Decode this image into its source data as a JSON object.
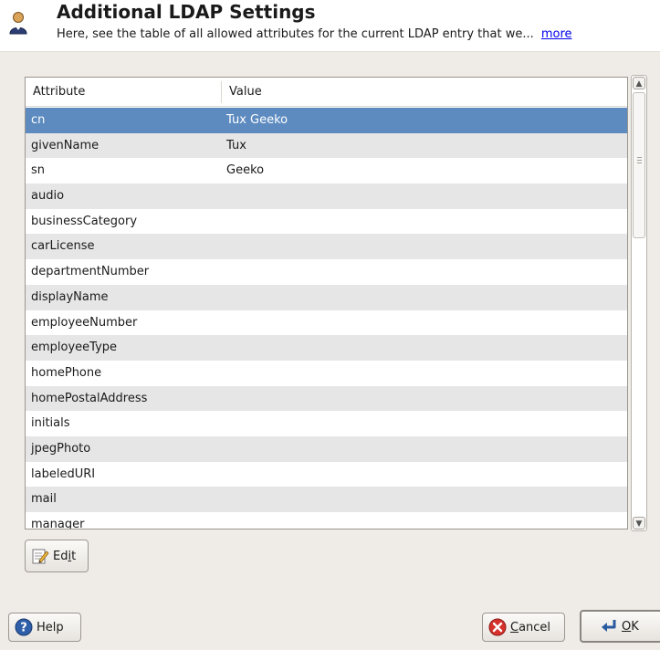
{
  "header": {
    "title": "Additional LDAP Settings",
    "subtitle": "Here, see the table of all allowed attributes for the current LDAP entry that we...",
    "more_link": "more"
  },
  "table": {
    "columns": [
      "Attribute",
      "Value"
    ],
    "rows": [
      {
        "attribute": "cn",
        "value": "Tux Geeko",
        "selected": true
      },
      {
        "attribute": "givenName",
        "value": "Tux"
      },
      {
        "attribute": "sn",
        "value": "Geeko"
      },
      {
        "attribute": "audio",
        "value": ""
      },
      {
        "attribute": "businessCategory",
        "value": ""
      },
      {
        "attribute": "carLicense",
        "value": ""
      },
      {
        "attribute": "departmentNumber",
        "value": ""
      },
      {
        "attribute": "displayName",
        "value": ""
      },
      {
        "attribute": "employeeNumber",
        "value": ""
      },
      {
        "attribute": "employeeType",
        "value": ""
      },
      {
        "attribute": "homePhone",
        "value": ""
      },
      {
        "attribute": "homePostalAddress",
        "value": ""
      },
      {
        "attribute": "initials",
        "value": ""
      },
      {
        "attribute": "jpegPhoto",
        "value": ""
      },
      {
        "attribute": "labeledURI",
        "value": ""
      },
      {
        "attribute": "mail",
        "value": ""
      },
      {
        "attribute": "manager",
        "value": ""
      }
    ]
  },
  "buttons": {
    "edit": {
      "label_pre": "Ed",
      "label_mnemonic": "i",
      "label_post": "t"
    },
    "help": {
      "label": "Help"
    },
    "cancel": {
      "label_mnemonic": "C",
      "label_post": "ancel"
    },
    "ok": {
      "label_mnemonic": "O",
      "label_post": "K"
    }
  },
  "icons": {
    "header": "user-icon",
    "edit": "edit-pencil-icon",
    "help": "help-icon",
    "cancel": "cancel-icon",
    "ok": "ok-return-icon"
  },
  "colors": {
    "selection": "#5d8bc0",
    "alt_row": "#e6e6e6",
    "link": "#0000ee"
  }
}
